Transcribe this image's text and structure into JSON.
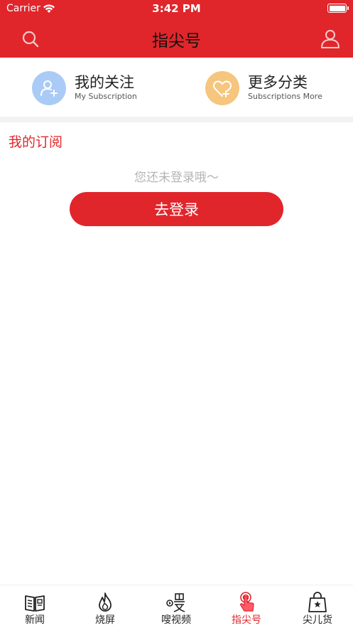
{
  "status_bar": {
    "carrier": "Carrier",
    "time": "3:42 PM"
  },
  "nav": {
    "title": "指尖号",
    "search_icon": "search-icon",
    "user_icon": "user-icon"
  },
  "shortcuts": [
    {
      "title": "我的关注",
      "subtitle": "My Subscription",
      "icon": "add-user-icon",
      "color": "#a9cbf6"
    },
    {
      "title": "更多分类",
      "subtitle": "Subscriptions More",
      "icon": "heart-plus-icon",
      "color": "#f6c57e"
    }
  ],
  "subscription": {
    "section_title": "我的订阅",
    "empty_hint": "您还未登录哦～",
    "login_label": "去登录"
  },
  "tabs": [
    {
      "label": "新闻",
      "icon": "newspaper-icon",
      "active": false
    },
    {
      "label": "烧屏",
      "icon": "flame-icon",
      "active": false
    },
    {
      "label": "嗖视频",
      "icon": "video-icon",
      "active": false
    },
    {
      "label": "指尖号",
      "icon": "finger-tap-icon",
      "active": true
    },
    {
      "label": "尖儿货",
      "icon": "shopping-bag-icon",
      "active": false
    }
  ],
  "colors": {
    "brand_red": "#e0262b",
    "hint_gray": "#b4b4b4"
  }
}
